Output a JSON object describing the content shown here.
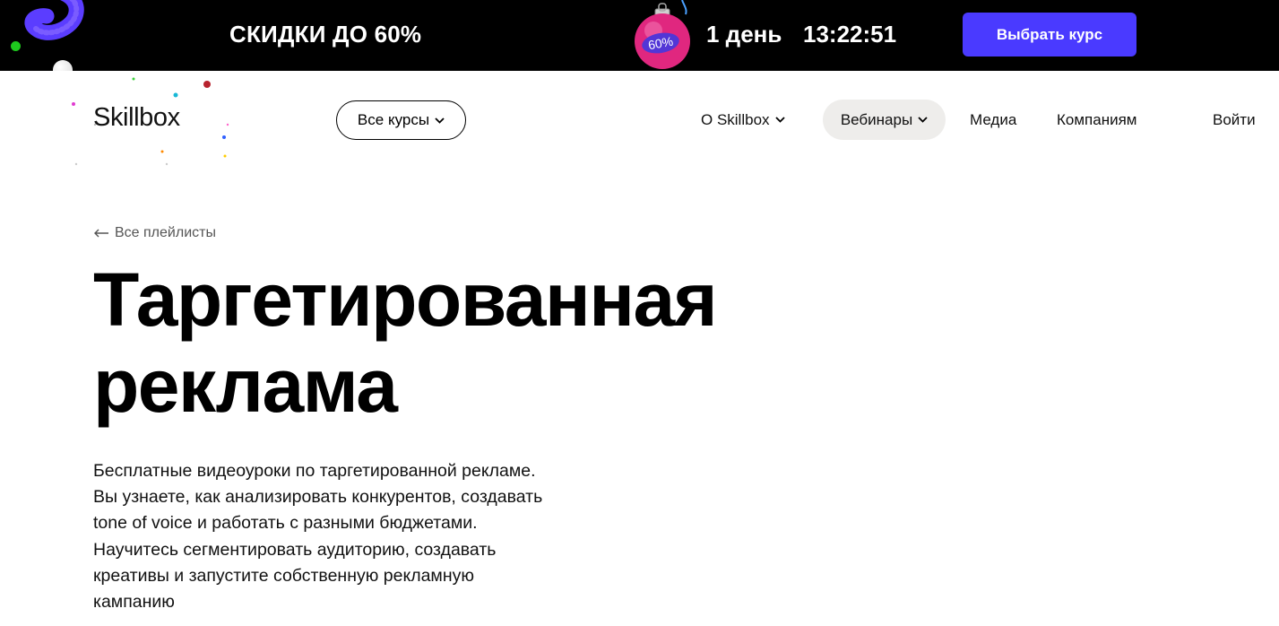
{
  "promo": {
    "headline": "СКИДКИ ДО 60%",
    "ornament_label": "60%",
    "days": "1 день",
    "timer": "13:22:51",
    "cta_label": "Выбрать курс",
    "colors": {
      "background": "#000000",
      "cta": "#4a3aff",
      "ornament": "#e0277f"
    }
  },
  "header": {
    "logo": "Skillbox",
    "all_courses_label": "Все курсы",
    "nav": {
      "about": "О Skillbox",
      "webinars": "Вебинары",
      "media": "Медиа",
      "companies": "Компаниям",
      "login": "Войти"
    }
  },
  "main": {
    "back_label": "Все плейлисты",
    "title_line1": "Таргетированная",
    "title_line2": "реклама",
    "description": "Бесплатные видеоуроки по таргетированной рекламе. Вы узнаете, как анализировать конкурентов, создавать tone of voice и работать с разными бюджетами. Научитесь сегментировать аудиторию, создавать креативы и запустите собственную рекламную кампанию"
  },
  "icons": {
    "back": "arrow-left-icon",
    "chevron": "chevron-down-icon"
  }
}
